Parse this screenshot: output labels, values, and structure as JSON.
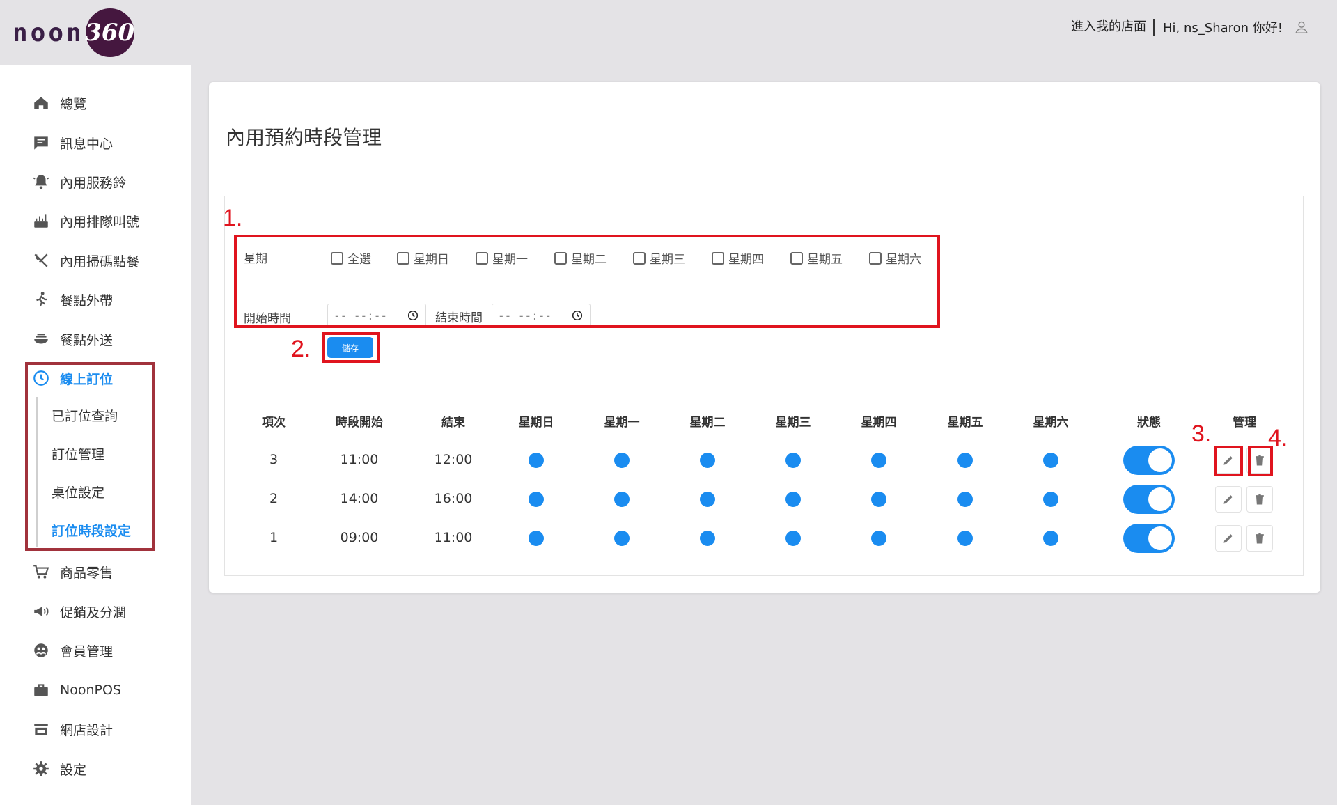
{
  "brand": {
    "logo_word": "noon",
    "logo_badge": "360"
  },
  "header": {
    "store_link": "進入我的店面",
    "greeting": "Hi, ns_Sharon 你好!"
  },
  "sidebar": {
    "items": [
      {
        "label": "總覽",
        "icon": "home-icon"
      },
      {
        "label": "訊息中心",
        "icon": "message-icon"
      },
      {
        "label": "內用服務鈴",
        "icon": "bell-icon"
      },
      {
        "label": "內用排隊叫號",
        "icon": "queue-icon"
      },
      {
        "label": "內用掃碼點餐",
        "icon": "utensils-icon"
      },
      {
        "label": "餐點外帶",
        "icon": "walk-icon"
      },
      {
        "label": "餐點外送",
        "icon": "delivery-icon"
      },
      {
        "label": "線上訂位",
        "icon": "clock-icon",
        "active": true
      },
      {
        "label": "商品零售",
        "icon": "cart-icon"
      },
      {
        "label": "促銷及分潤",
        "icon": "megaphone-icon"
      },
      {
        "label": "會員管理",
        "icon": "members-icon"
      },
      {
        "label": "NoonPOS",
        "icon": "briefcase-icon"
      },
      {
        "label": "網店設計",
        "icon": "storefront-icon"
      },
      {
        "label": "設定",
        "icon": "gear-icon"
      }
    ],
    "sub_items": [
      {
        "label": "已訂位查詢"
      },
      {
        "label": "訂位管理"
      },
      {
        "label": "桌位設定"
      },
      {
        "label": "訂位時段設定",
        "active": true
      }
    ]
  },
  "page": {
    "title": "內用預約時段管理"
  },
  "form": {
    "weekday_label": "星期",
    "checkboxes": [
      "全選",
      "星期日",
      "星期一",
      "星期二",
      "星期三",
      "星期四",
      "星期五",
      "星期六"
    ],
    "start_label": "開始時間",
    "end_label": "結束時間",
    "time_placeholder": "-- --:--",
    "save_label": "儲存"
  },
  "markers": [
    "1.",
    "2.",
    "3.",
    "4."
  ],
  "table": {
    "headers": [
      "項次",
      "時段開始",
      "結束",
      "星期日",
      "星期一",
      "星期二",
      "星期三",
      "星期四",
      "星期五",
      "星期六",
      "狀態",
      "管理"
    ],
    "rows": [
      {
        "index": "3",
        "start": "11:00",
        "end": "12:00",
        "days": [
          true,
          true,
          true,
          true,
          true,
          true,
          true
        ],
        "enabled": true
      },
      {
        "index": "2",
        "start": "14:00",
        "end": "16:00",
        "days": [
          true,
          true,
          true,
          true,
          true,
          true,
          true
        ],
        "enabled": true
      },
      {
        "index": "1",
        "start": "09:00",
        "end": "11:00",
        "days": [
          true,
          true,
          true,
          true,
          true,
          true,
          true
        ],
        "enabled": true
      }
    ]
  },
  "colors": {
    "accent": "#1a8cf0",
    "annotation": "#e0141e",
    "brand": "#45173f"
  }
}
